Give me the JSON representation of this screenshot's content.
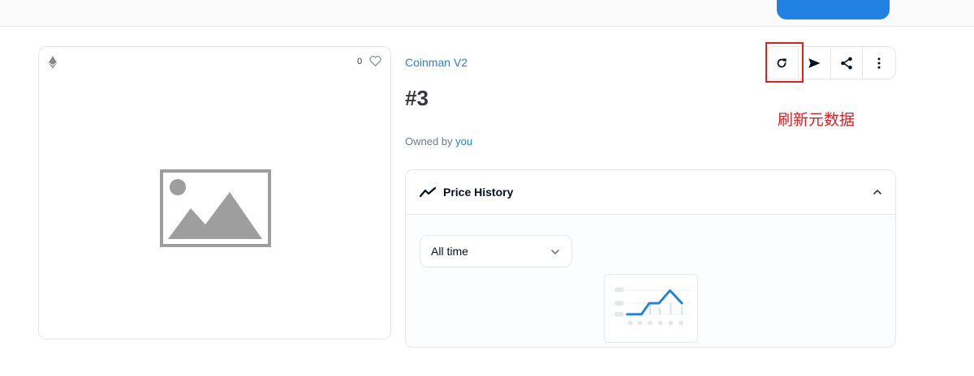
{
  "header": {
    "primary_button_label": ""
  },
  "asset": {
    "chain_icon": "ethereum-icon",
    "favorite_count": "0",
    "favorite_icon": "heart-icon",
    "image_icon": "image-placeholder-icon"
  },
  "item": {
    "collection": "Coinman V2",
    "token_id": "#3",
    "owned_by_label": "Owned by ",
    "owner": "you"
  },
  "actions": {
    "icons": [
      "refresh-icon",
      "send-icon",
      "share-icon",
      "more-vertical-icon"
    ]
  },
  "annotation": {
    "text": "刷新元数据",
    "color": "#e02020"
  },
  "price_history": {
    "title": "Price History",
    "icon": "trend-line-icon",
    "period_selected": "All time",
    "empty_state_icon": "empty-chart-icon"
  },
  "colors": {
    "accent": "#2081e2",
    "text": "#04111d",
    "muted": "#707a83",
    "border": "#e5e8eb",
    "highlight": "#e02020"
  }
}
